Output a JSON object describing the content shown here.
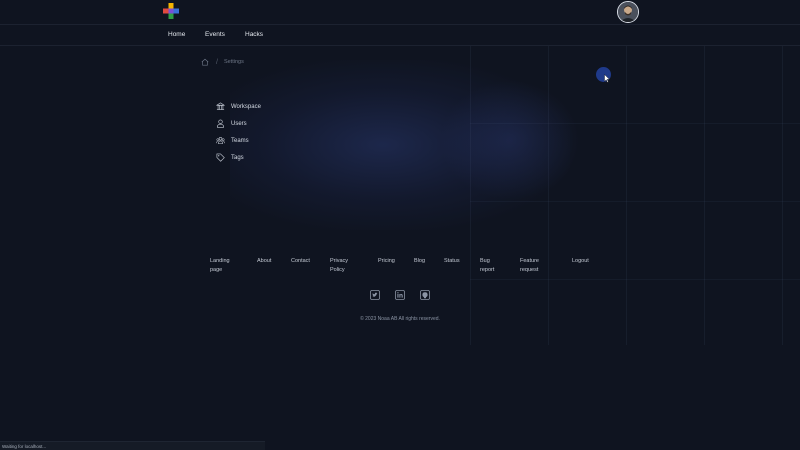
{
  "nav": {
    "items": [
      {
        "label": "Home"
      },
      {
        "label": "Events"
      },
      {
        "label": "Hacks"
      }
    ]
  },
  "breadcrumb": {
    "current": "Settings"
  },
  "settings_menu": {
    "items": [
      {
        "label": "Workspace",
        "icon": "building-icon"
      },
      {
        "label": "Users",
        "icon": "user-icon"
      },
      {
        "label": "Teams",
        "icon": "team-icon"
      },
      {
        "label": "Tags",
        "icon": "tag-icon"
      }
    ]
  },
  "footer": {
    "links": [
      {
        "label": "Landing page"
      },
      {
        "label": "About"
      },
      {
        "label": "Contact"
      },
      {
        "label": "Privacy Policy"
      },
      {
        "label": "Pricing"
      },
      {
        "label": "Blog"
      },
      {
        "label": "Status"
      },
      {
        "label": "Bug report"
      },
      {
        "label": "Feature request"
      },
      {
        "label": "Logout"
      }
    ],
    "social": [
      "twitter-icon",
      "linkedin-icon",
      "github-icon"
    ],
    "copyright": "© 2023 Noaa AB All rights reserved."
  },
  "status_bar": {
    "text": "Waiting for localhost..."
  },
  "colors": {
    "background": "#0f1420",
    "accent": "#1f3a8a",
    "logo_colors": [
      "#f5b400",
      "#e04a3f",
      "#2f9e44",
      "#3b6fd8"
    ]
  }
}
